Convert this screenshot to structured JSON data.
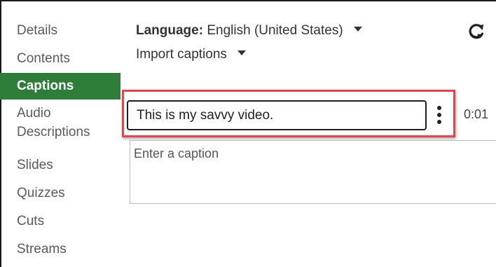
{
  "sidebar": {
    "items": [
      {
        "label": "Details"
      },
      {
        "label": "Contents"
      },
      {
        "label": "Captions"
      },
      {
        "label": "Audio Descriptions"
      },
      {
        "label": "Slides"
      },
      {
        "label": "Quizzes"
      },
      {
        "label": "Cuts"
      },
      {
        "label": "Streams"
      }
    ],
    "active_label": "Captions"
  },
  "header": {
    "language_label": "Language:",
    "language_value": "English (United States)",
    "import_label": "Import captions",
    "refresh_icon": "refresh-icon"
  },
  "captions": {
    "items": [
      {
        "text": "This is my savvy video.",
        "time": "0:01"
      }
    ],
    "new_placeholder": "Enter a caption"
  },
  "colors": {
    "active_nav_bg": "#2f7d3a",
    "highlight_border": "#e0464f"
  }
}
